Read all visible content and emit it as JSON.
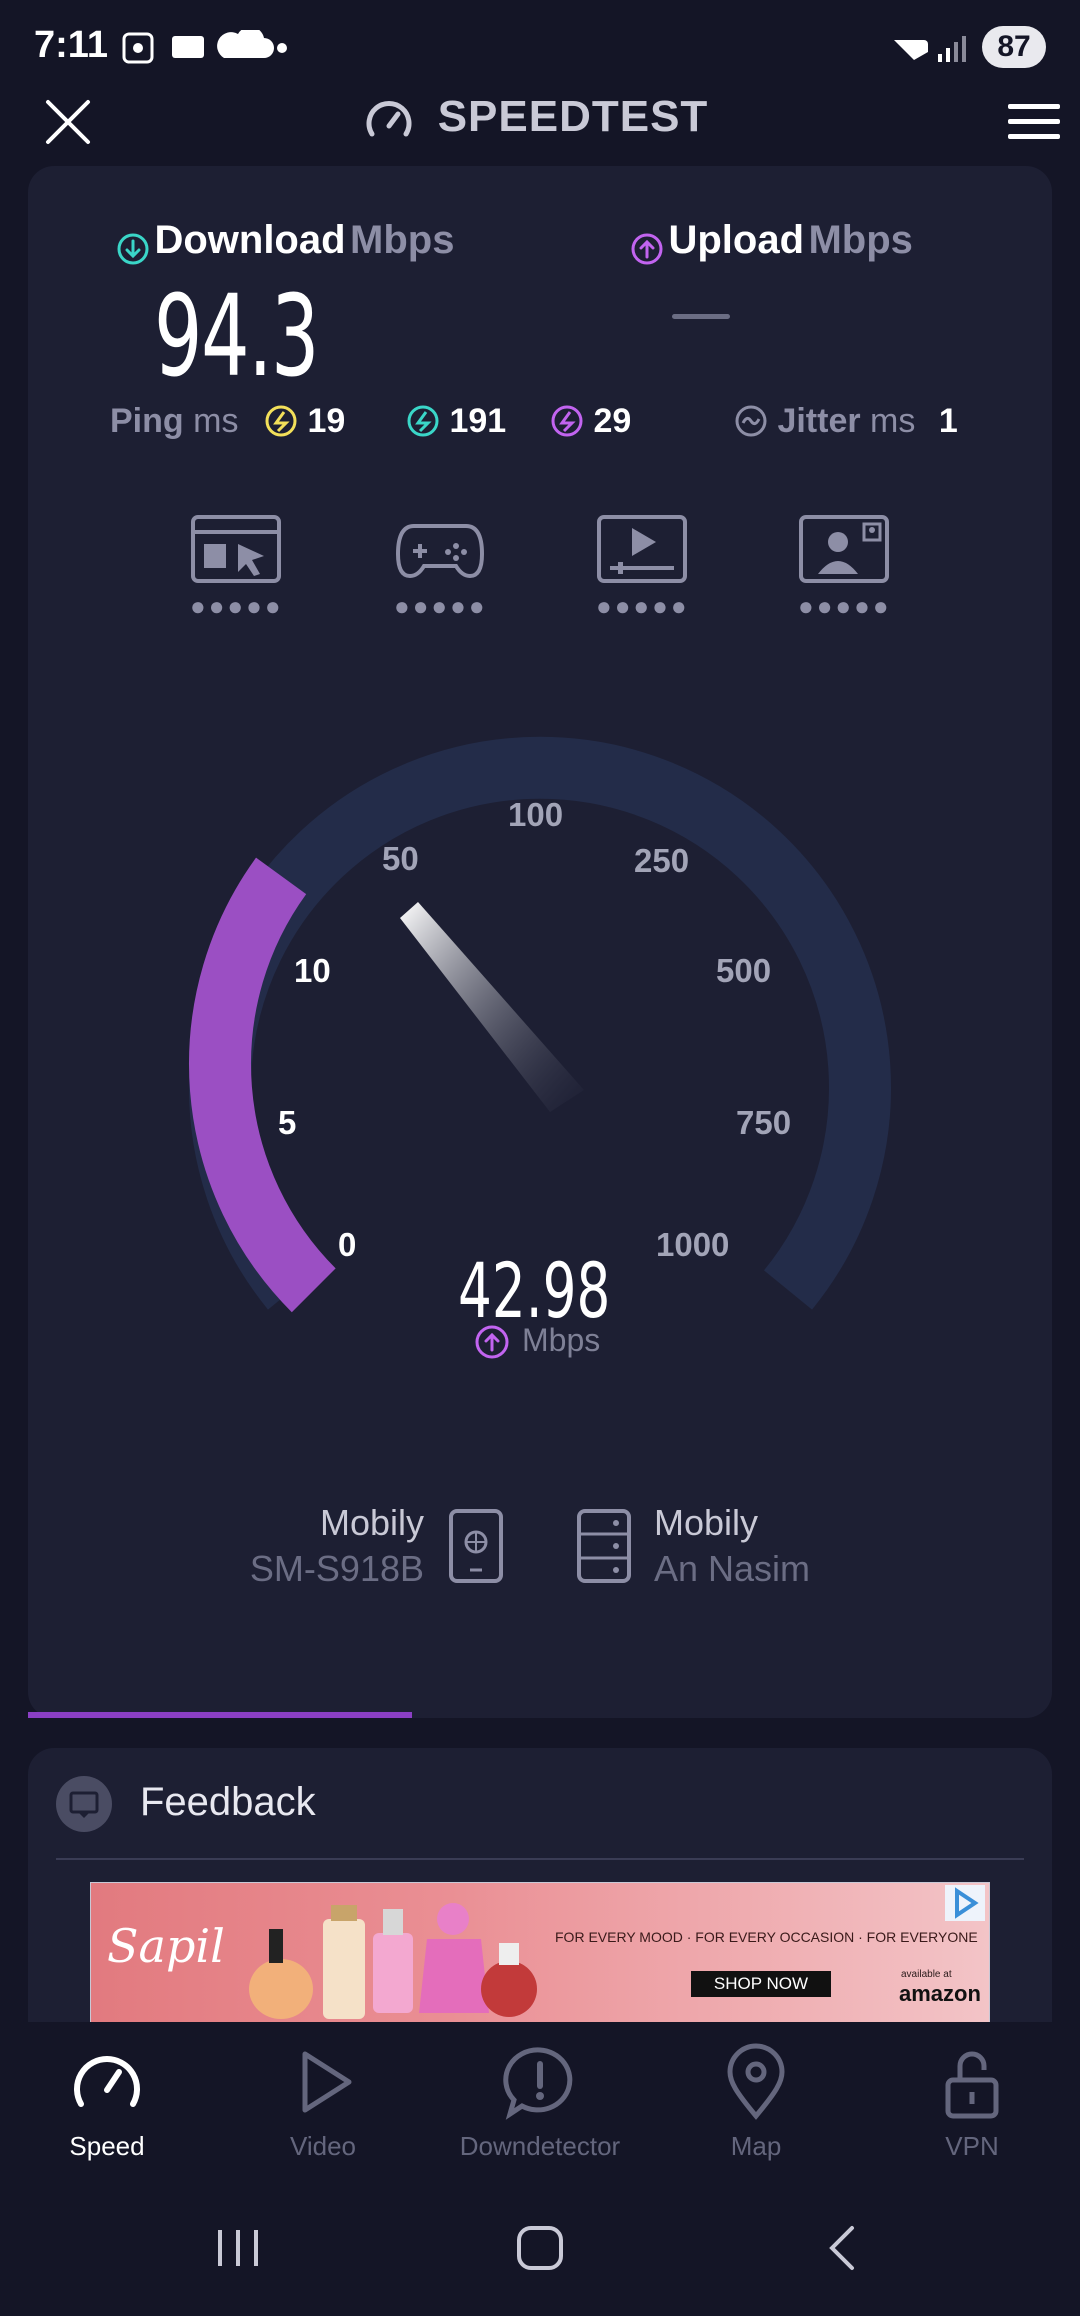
{
  "status_bar": {
    "time": "7:11",
    "battery": "87"
  },
  "header": {
    "title": "SPEEDTEST",
    "close_icon": "close-icon",
    "menu_icon": "hamburger-menu-icon"
  },
  "download": {
    "label": "Download",
    "unit": "Mbps",
    "value": "94.3"
  },
  "upload": {
    "label": "Upload",
    "unit": "Mbps",
    "value": "—"
  },
  "ping": {
    "label": "Ping",
    "unit": "ms",
    "idle": "19",
    "download": "191",
    "upload": "29"
  },
  "jitter": {
    "label": "Jitter",
    "unit": "ms",
    "value": "1"
  },
  "gauge": {
    "ticks": [
      "0",
      "5",
      "10",
      "50",
      "100",
      "250",
      "500",
      "750",
      "1000"
    ],
    "current_value": "42.98",
    "unit": "Mbps",
    "fill_fraction": 0.3,
    "colors": {
      "active": "#9b4fc3",
      "track": "#232c49"
    }
  },
  "connection": {
    "provider": "Mobily",
    "device": "SM-S918B",
    "server_name": "Mobily",
    "server_location": "An Nasim"
  },
  "feedback": {
    "label": "Feedback"
  },
  "ad": {
    "brand": "Sapil",
    "tagline": "FOR EVERY MOOD · FOR EVERY OCCASION · FOR EVERYONE",
    "cta": "SHOP NOW",
    "available": "available at",
    "store": "amazon"
  },
  "nav": {
    "items": [
      {
        "label": "Speed",
        "icon": "speedometer-icon",
        "active": true
      },
      {
        "label": "Video",
        "icon": "play-icon",
        "active": false
      },
      {
        "label": "Downdetector",
        "icon": "alert-icon",
        "active": false
      },
      {
        "label": "Map",
        "icon": "map-pin-icon",
        "active": false
      },
      {
        "label": "VPN",
        "icon": "unlock-icon",
        "active": false
      }
    ]
  }
}
